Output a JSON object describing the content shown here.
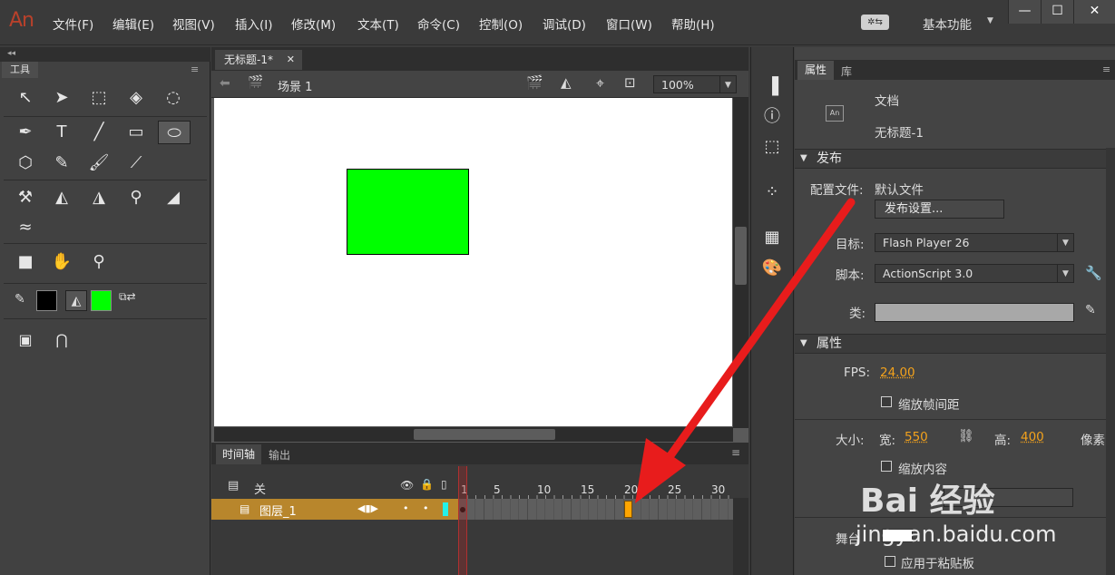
{
  "menubar": {
    "logo": "An",
    "items": [
      "文件(F)",
      "编辑(E)",
      "视图(V)",
      "插入(I)",
      "修改(M)",
      "文本(T)",
      "命令(C)",
      "控制(O)",
      "调试(D)",
      "窗口(W)",
      "帮助(H)"
    ],
    "workspace_label": "基本功能",
    "window_buttons": [
      "—",
      "☐",
      "✕"
    ]
  },
  "tools_panel": {
    "tab_label": "工具",
    "tools": [
      "selection-tool",
      "subselection-tool",
      "free-transform-tool",
      "3d-rotation-tool",
      "lasso-tool",
      "pen-tool",
      "text-tool",
      "line-tool",
      "rectangle-tool",
      "oval-tool",
      "polystar-tool",
      "pencil-tool",
      "brush-tool",
      "paint-brush-tool",
      "bone-tool",
      "paint-bucket-tool",
      "ink-bottle-tool",
      "eyedropper-tool",
      "eraser-tool",
      "width-tool",
      "camera-tool",
      "hand-tool",
      "zoom-tool"
    ],
    "stroke_color": "#000000",
    "fill_color": "#00ff00"
  },
  "document": {
    "tab_title": "无标题-1*",
    "scene_label": "场景 1",
    "zoom": "100%",
    "rect_color": "#00ff00"
  },
  "timeline": {
    "tabs": [
      "时间轴",
      "输出"
    ],
    "header_label": "关",
    "layer_name": "图层_1",
    "ruler_numbers": [
      "1",
      "5",
      "10",
      "15",
      "20",
      "25",
      "30"
    ],
    "keyframe_at": 20
  },
  "properties": {
    "tabs": [
      "属性",
      "库"
    ],
    "doc_type": "文档",
    "doc_name": "无标题-1",
    "publish_section": "发布",
    "profile_label": "配置文件:",
    "profile_value": "默认文件",
    "publish_settings_button": "发布设置...",
    "target_label": "目标:",
    "target_value": "Flash Player 26",
    "script_label": "脚本:",
    "script_value": "ActionScript 3.0",
    "class_label": "类:",
    "props_section": "属性",
    "fps_label": "FPS:",
    "fps_value": "24.00",
    "scale_spans_label": "缩放帧间距",
    "size_label": "大小:",
    "width_label": "宽:",
    "width_value": "550",
    "height_label": "高:",
    "height_value": "400",
    "unit_label": "像素",
    "scale_content_label": "缩放内容",
    "stage_label": "舞台",
    "apply_clipboard_label": "应用于粘贴板"
  },
  "watermark": {
    "logo_text": "Bai 经验",
    "url_text": "jingyan.baidu.com"
  }
}
